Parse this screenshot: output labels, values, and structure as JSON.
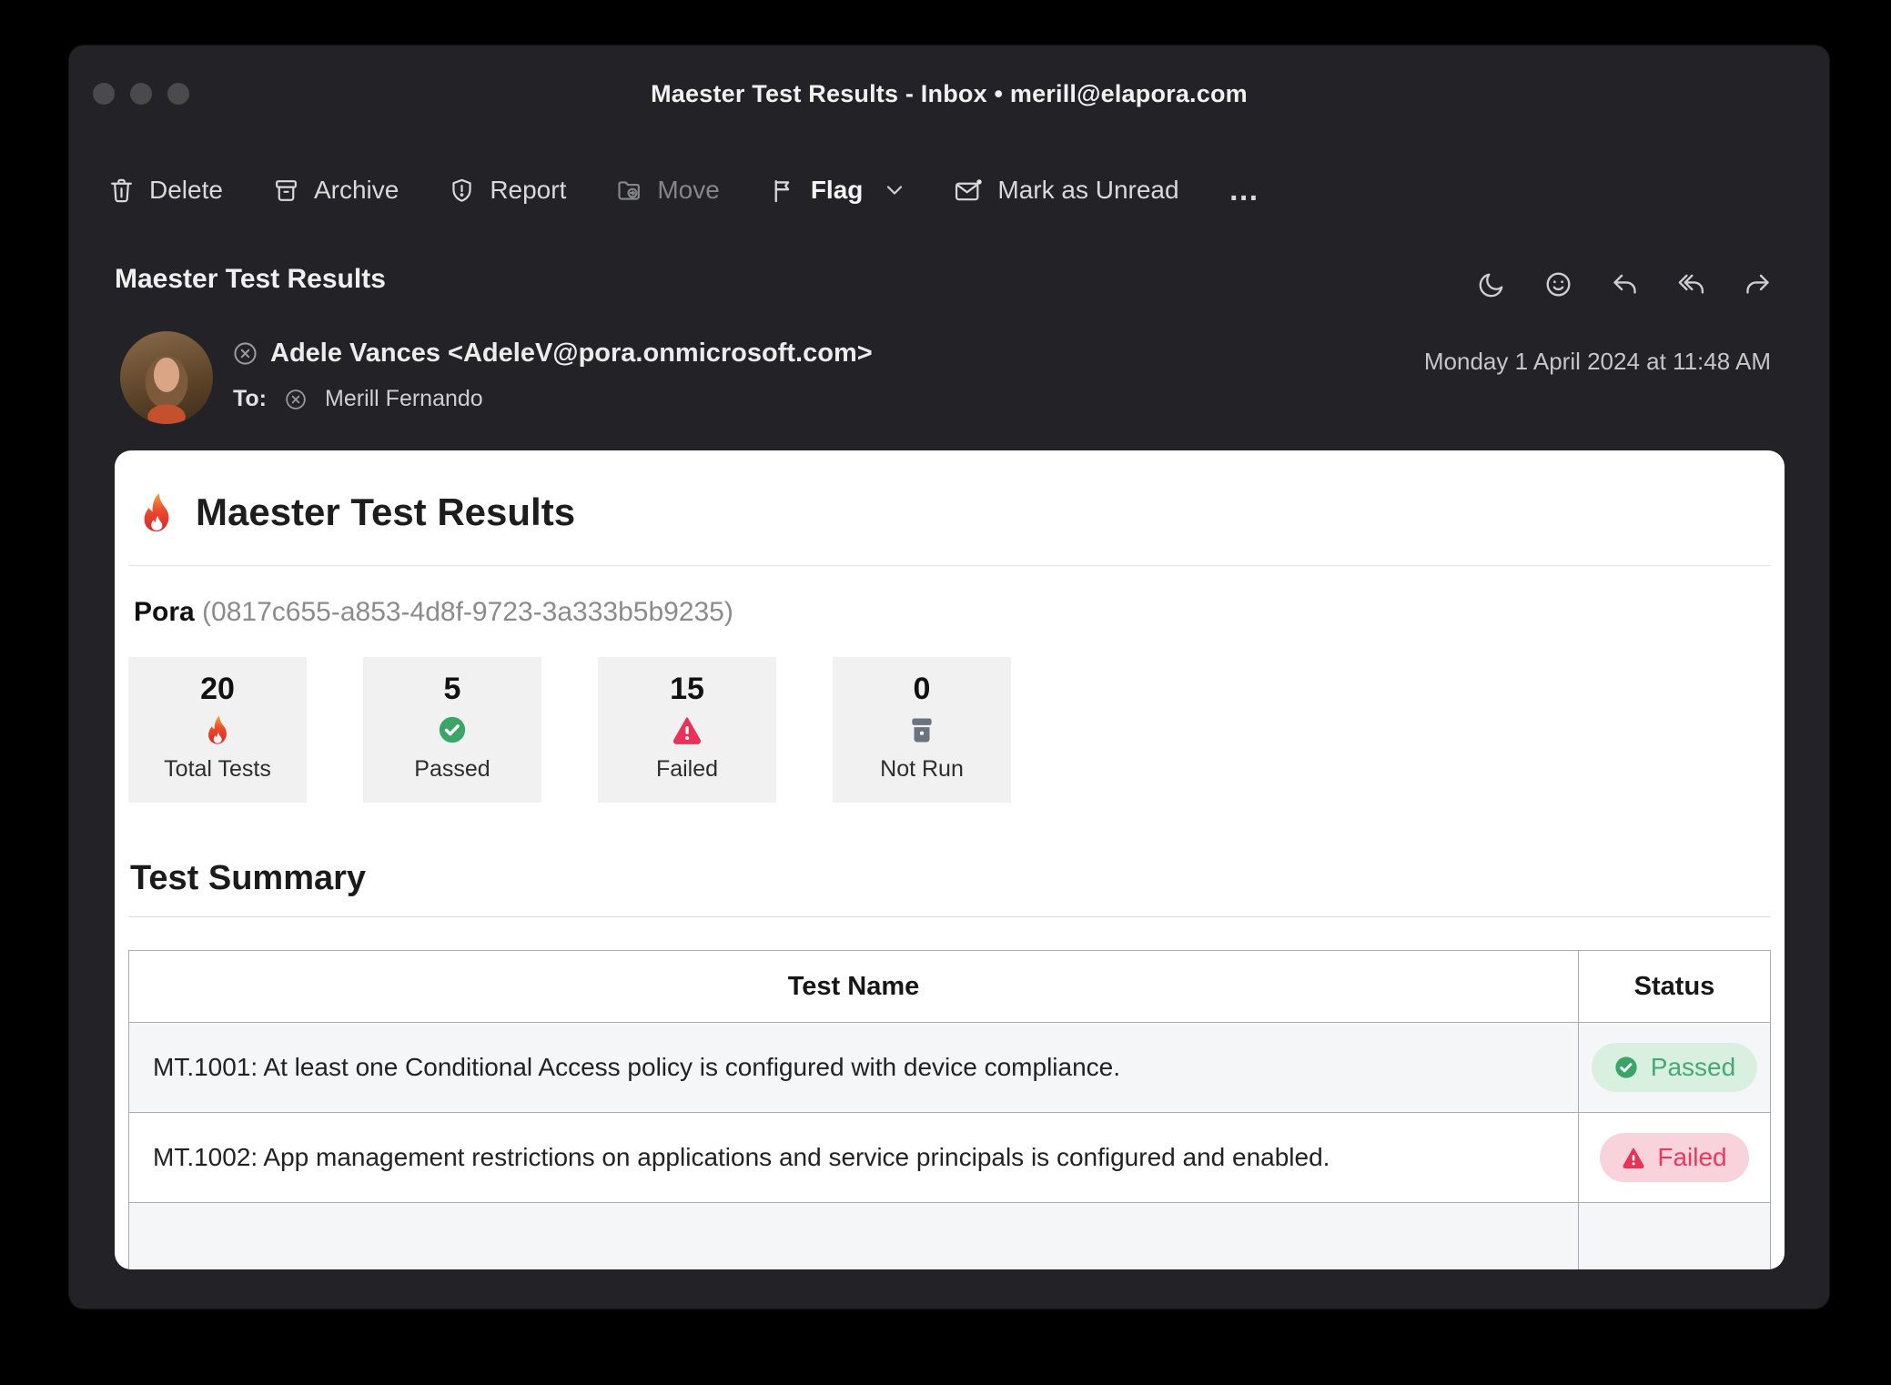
{
  "window": {
    "title": "Maester Test Results - Inbox • merill@elapora.com",
    "controls": [
      "close",
      "minimize",
      "zoom"
    ]
  },
  "toolbar": {
    "items": [
      {
        "icon": "trash-icon",
        "label": "Delete",
        "enabled": true
      },
      {
        "icon": "archive-icon",
        "label": "Archive",
        "enabled": true
      },
      {
        "icon": "report-shield-icon",
        "label": "Report",
        "enabled": true
      },
      {
        "icon": "move-folder-icon",
        "label": "Move",
        "enabled": false
      },
      {
        "icon": "flag-icon",
        "label": "Flag",
        "enabled": true,
        "has_dropdown": true
      },
      {
        "icon": "mail-unread-icon",
        "label": "Mark as Unread",
        "enabled": true
      },
      {
        "icon": "more-icon",
        "label": "…",
        "enabled": true
      }
    ]
  },
  "message": {
    "subject": "Maester Test Results",
    "sender": "Adele Vances <AdeleV@pora.onmicrosoft.com>",
    "to_label": "To:",
    "recipient": "Merill Fernando",
    "date": "Monday 1 April 2024 at 11:48 AM",
    "header_actions": [
      "snooze-moon-icon",
      "reaction-smiley-icon",
      "reply-icon",
      "reply-all-icon",
      "forward-icon"
    ]
  },
  "email": {
    "title": "Maester Test Results",
    "tenant_name": "Pora",
    "tenant_id": "(0817c655-a853-4d8f-9723-3a333b5b9235)",
    "stats": [
      {
        "value": "20",
        "label": "Total Tests",
        "icon": "flame-icon"
      },
      {
        "value": "5",
        "label": "Passed",
        "icon": "check-circle-icon"
      },
      {
        "value": "15",
        "label": "Failed",
        "icon": "warning-triangle-icon"
      },
      {
        "value": "0",
        "label": "Not Run",
        "icon": "archive-box-icon"
      }
    ],
    "summary_heading": "Test Summary",
    "table": {
      "header_name": "Test Name",
      "header_status": "Status",
      "rows": [
        {
          "name": "MT.1001: At least one Conditional Access policy is configured with device compliance.",
          "status": "Passed",
          "status_icon": "check-circle-icon"
        },
        {
          "name": "MT.1002: App management restrictions on applications and service principals is configured and enabled.",
          "status": "Failed",
          "status_icon": "warning-triangle-icon"
        }
      ]
    }
  },
  "colors": {
    "passed_text": "#46a874",
    "passed_bg": "#d9f0e1",
    "failed_text": "#e73a5e",
    "failed_bg": "#f9d3db",
    "flame_orange": "#f6a13c",
    "flame_red": "#dc2626",
    "not_run_gray": "#6b7280",
    "window_bg": "#232327"
  }
}
